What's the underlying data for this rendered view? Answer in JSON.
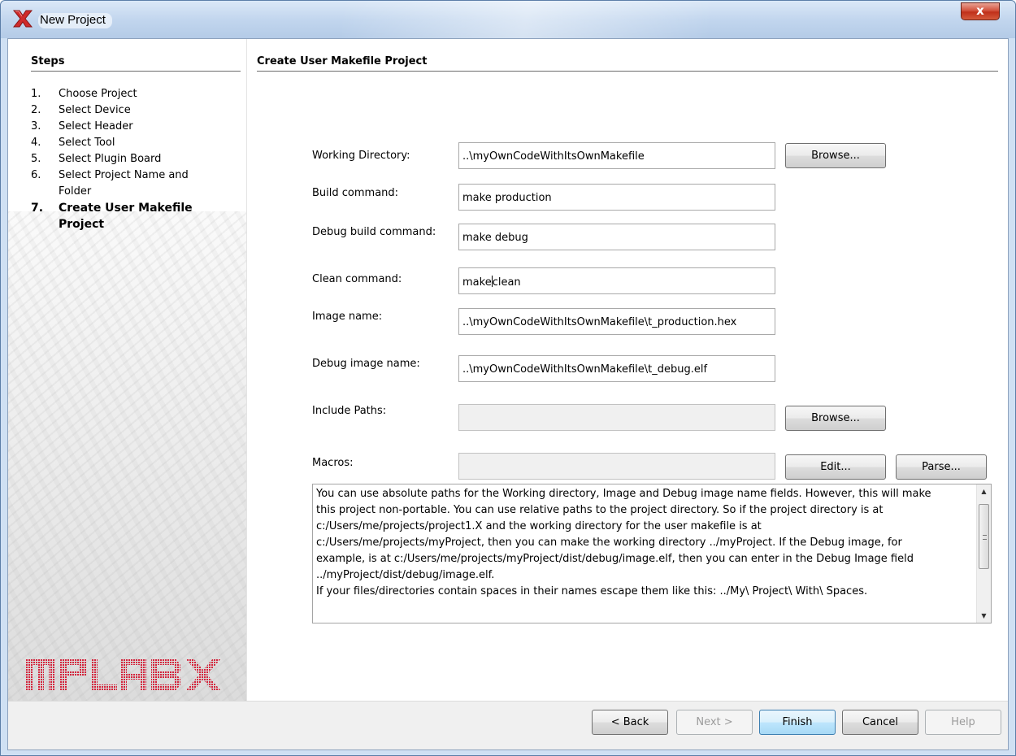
{
  "window": {
    "title": "New Project",
    "close_glyph": "x"
  },
  "sidebar": {
    "title": "Steps",
    "steps": [
      {
        "num": "1.",
        "label": "Choose Project"
      },
      {
        "num": "2.",
        "label": "Select Device"
      },
      {
        "num": "3.",
        "label": "Select Header"
      },
      {
        "num": "4.",
        "label": "Select Tool"
      },
      {
        "num": "5.",
        "label": "Select Plugin Board"
      },
      {
        "num": "6.",
        "label": "Select Project Name and Folder"
      },
      {
        "num": "7.",
        "label": "Create User Makefile Project"
      }
    ],
    "logo_text": "MPLABX"
  },
  "main": {
    "title": "Create User Makefile Project",
    "fields": {
      "working_directory": {
        "label": "Working Directory:",
        "value": "..\\myOwnCodeWithItsOwnMakefile"
      },
      "build_command": {
        "label": "Build command:",
        "value": "make production"
      },
      "debug_build_command": {
        "label": "Debug build command:",
        "value": "make debug"
      },
      "clean_command": {
        "label": "Clean command:",
        "value_before_caret": "make",
        "value_after_caret": "clean"
      },
      "image_name": {
        "label": "Image name:",
        "value": "..\\myOwnCodeWithItsOwnMakefile\\t_production.hex"
      },
      "debug_image_name": {
        "label": "Debug image name:",
        "value": "..\\myOwnCodeWithItsOwnMakefile\\t_debug.elf"
      },
      "include_paths": {
        "label": "Include Paths:",
        "value": ""
      },
      "macros": {
        "label": "Macros:",
        "value": ""
      }
    },
    "buttons": {
      "browse_working": "Browse...",
      "browse_include": "Browse...",
      "edit_macros": "Edit...",
      "parse_macros": "Parse..."
    },
    "help_text": "You can use absolute paths for the Working directory, Image and Debug image name fields. However, this will make\nthis project non-portable. You can use relative paths to the project directory. So if the project directory is at\nc:/Users/me/projects/project1.X and the working directory for the user makefile is at\nc:/Users/me/projects/myProject, then you can make the working directory ../myProject. If the Debug image, for\nexample, is at c:/Users/me/projects/myProject/dist/debug/image.elf, then you can enter in the Debug Image field\n../myProject/dist/debug/image.elf.\nIf your files/directories contain spaces in their names escape them like this: ../My\\ Project\\ With\\ Spaces."
  },
  "footer": {
    "back": "< Back",
    "next": "Next >",
    "finish": "Finish",
    "cancel": "Cancel",
    "help": "Help"
  },
  "colors": {
    "title_bar": "#c2d6ee",
    "close_button": "#c0301a",
    "logo_red": "#d4243c"
  }
}
